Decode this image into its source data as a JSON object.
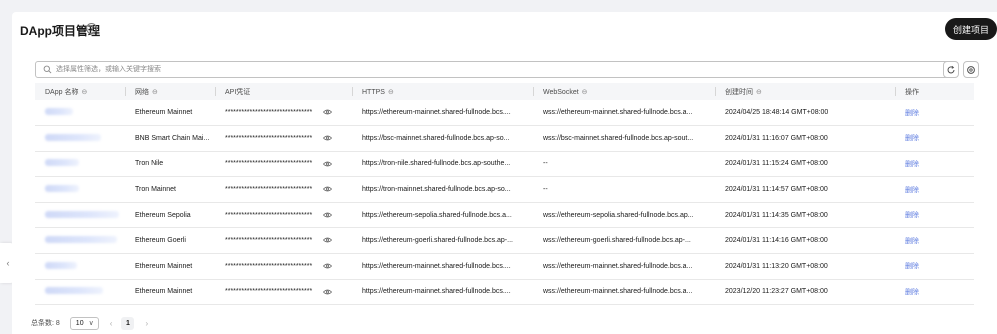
{
  "header": {
    "title": "DApp项目管理",
    "help_icon": "?",
    "create_button": "创建项目"
  },
  "search": {
    "placeholder": "选择属性筛选，或输入关键字搜索"
  },
  "toolbar": {
    "refresh_icon": "refresh-icon",
    "settings_icon": "settings-icon"
  },
  "table": {
    "columns": [
      {
        "label": "DApp 名称",
        "sortable": true
      },
      {
        "label": "网络",
        "sortable": true
      },
      {
        "label": "API凭证",
        "sortable": false
      },
      {
        "label": "HTTPS",
        "sortable": true
      },
      {
        "label": "WebSocket",
        "sortable": true
      },
      {
        "label": "创建时间",
        "sortable": true
      },
      {
        "label": "操作",
        "sortable": false
      }
    ],
    "sort_glyph": "⊖",
    "rows": [
      {
        "network": "Ethereum Mainnet",
        "credential": "********************************",
        "https": "https://ethereum-mainnet.shared-fullnode.bcs....",
        "ws": "wss://ethereum-mainnet.shared-fullnode.bcs.a...",
        "created": "2024/04/25 18:48:14 GMT+08:00",
        "action": "删除"
      },
      {
        "network": "BNB Smart Chain Mai...",
        "credential": "********************************",
        "https": "https://bsc-mainnet.shared-fullnode.bcs.ap-so...",
        "ws": "wss://bsc-mainnet.shared-fullnode.bcs.ap-sout...",
        "created": "2024/01/31 11:16:07 GMT+08:00",
        "action": "删除"
      },
      {
        "network": "Tron Nile",
        "credential": "********************************",
        "https": "https://tron-nile.shared-fullnode.bcs.ap-southe...",
        "ws": "--",
        "created": "2024/01/31 11:15:24 GMT+08:00",
        "action": "删除"
      },
      {
        "network": "Tron Mainnet",
        "credential": "********************************",
        "https": "https://tron-mainnet.shared-fullnode.bcs.ap-so...",
        "ws": "--",
        "created": "2024/01/31 11:14:57 GMT+08:00",
        "action": "删除"
      },
      {
        "network": "Ethereum Sepolia",
        "credential": "********************************",
        "https": "https://ethereum-sepolia.shared-fullnode.bcs.a...",
        "ws": "wss://ethereum-sepolia.shared-fullnode.bcs.ap...",
        "created": "2024/01/31 11:14:35 GMT+08:00",
        "action": "删除"
      },
      {
        "network": "Ethereum Goerli",
        "credential": "********************************",
        "https": "https://ethereum-goerli.shared-fullnode.bcs.ap-...",
        "ws": "wss://ethereum-goerli.shared-fullnode.bcs.ap-...",
        "created": "2024/01/31 11:14:16 GMT+08:00",
        "action": "删除"
      },
      {
        "network": "Ethereum Mainnet",
        "credential": "********************************",
        "https": "https://ethereum-mainnet.shared-fullnode.bcs....",
        "ws": "wss://ethereum-mainnet.shared-fullnode.bcs.a...",
        "created": "2024/01/31 11:13:20 GMT+08:00",
        "action": "删除"
      },
      {
        "network": "Ethereum Mainnet",
        "credential": "********************************",
        "https": "https://ethereum-mainnet.shared-fullnode.bcs....",
        "ws": "wss://ethereum-mainnet.shared-fullnode.bcs.a...",
        "created": "2023/12/20 11:23:27 GMT+08:00",
        "action": "删除"
      }
    ]
  },
  "pagination": {
    "total_label": "总条数: 8",
    "page_size": "10",
    "prev": "‹",
    "current_page": "1",
    "next": "›"
  },
  "sidebar_toggle": "‹",
  "colors": {
    "accent": "#5e7ce0",
    "primary_button": "#191919",
    "background": "#f1f2f5"
  }
}
